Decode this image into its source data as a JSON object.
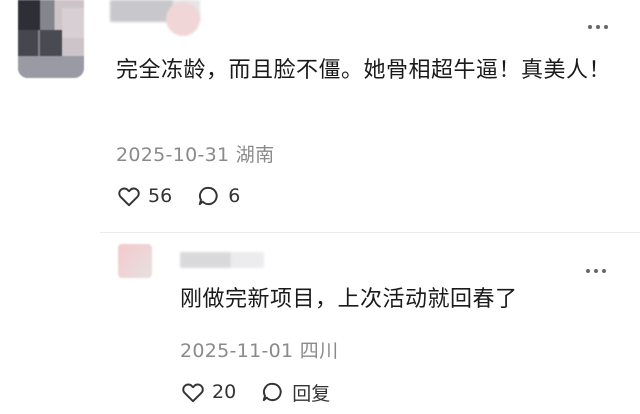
{
  "comment": {
    "text": "完全冻龄，而且脸不僵。她骨相超牛逼！真美人！",
    "date": "2025-10-31",
    "location": "湖南",
    "likes": "56",
    "replies": "6",
    "icons": {
      "like": "heart-outline-icon",
      "comment": "speech-bubble-icon",
      "more": "more-dots-icon"
    }
  },
  "reply": {
    "text": "刚做完新项目，上次活动就回春了",
    "date": "2025-11-01",
    "location": "四川",
    "likes": "20",
    "reply_label": "回复"
  },
  "colors": {
    "text": "#1a1a1a",
    "meta": "#8a8a8a",
    "icon": "#333333"
  }
}
